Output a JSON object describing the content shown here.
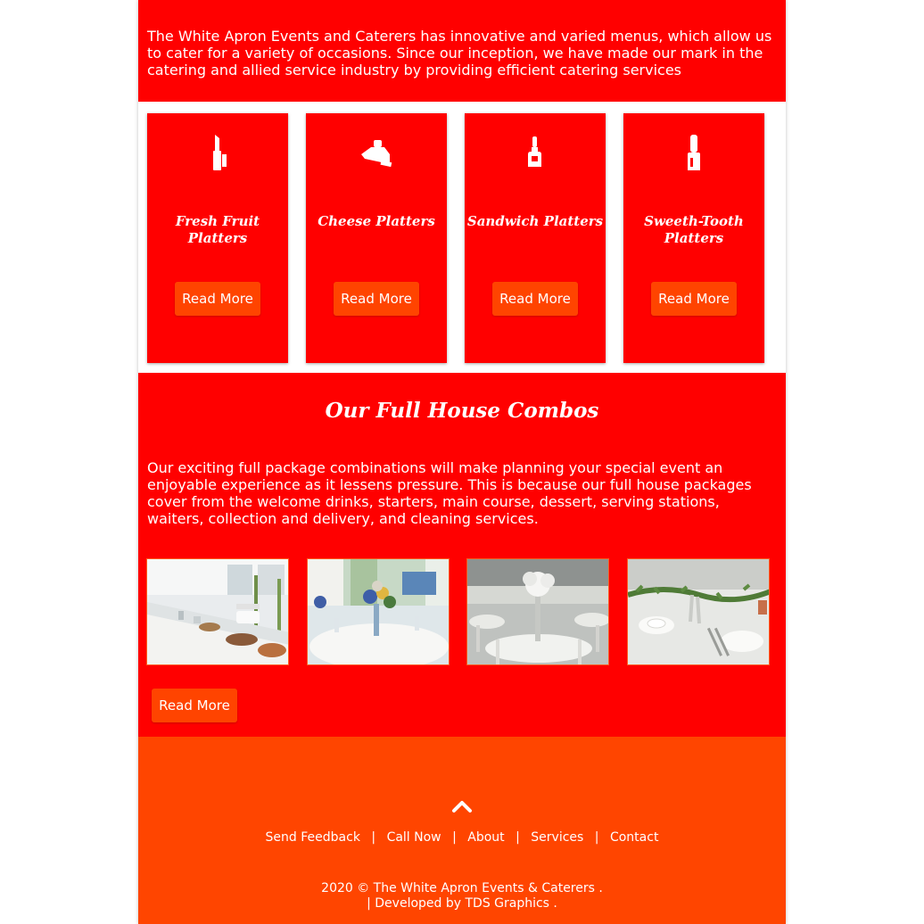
{
  "intro": {
    "text": "The White Apron Events and Caterers has innovative and varied menus, which allow us to cater for a variety of occasions. Since our inception, we have made our mark in the catering and allied service industry by providing efficient catering services"
  },
  "cards": [
    {
      "icon": "lipstick-icon",
      "title": "Fresh Fruit Platters",
      "button": "Read More"
    },
    {
      "icon": "cream-tube-icon",
      "title": "Cheese Platters",
      "button": "Read More"
    },
    {
      "icon": "perfume-bottle-icon",
      "title": "Sandwich Platters",
      "button": "Read More"
    },
    {
      "icon": "nail-polish-icon",
      "title": "Sweeth-Tooth Platters",
      "button": "Read More"
    }
  ],
  "combos": {
    "heading": "Our Full House Combos",
    "text": "Our exciting full package combinations will make planning your special event an enjoyable experience as it lessens pressure. This is because our full house packages cover from the welcome drinks, starters, main course, dessert, serving stations, waiters, collection and delivery, and cleaning services.",
    "button": "Read More",
    "photos": [
      "buffet-table-photo",
      "round-table-flowers-photo",
      "wedding-hall-tables-photo",
      "table-setting-greenery-photo"
    ]
  },
  "footer": {
    "nav": [
      "Send Feedback",
      "Call Now",
      "About",
      "Services",
      "Contact"
    ],
    "separator": "|",
    "copyright": "2020 ©  The White Apron Events & Caterers .",
    "developed": "| Developed by  TDS Graphics ."
  },
  "colors": {
    "primary_red": "#ff0000",
    "accent_orange": "#ff4500",
    "button": "#ff4400",
    "text": "#ffffff"
  }
}
